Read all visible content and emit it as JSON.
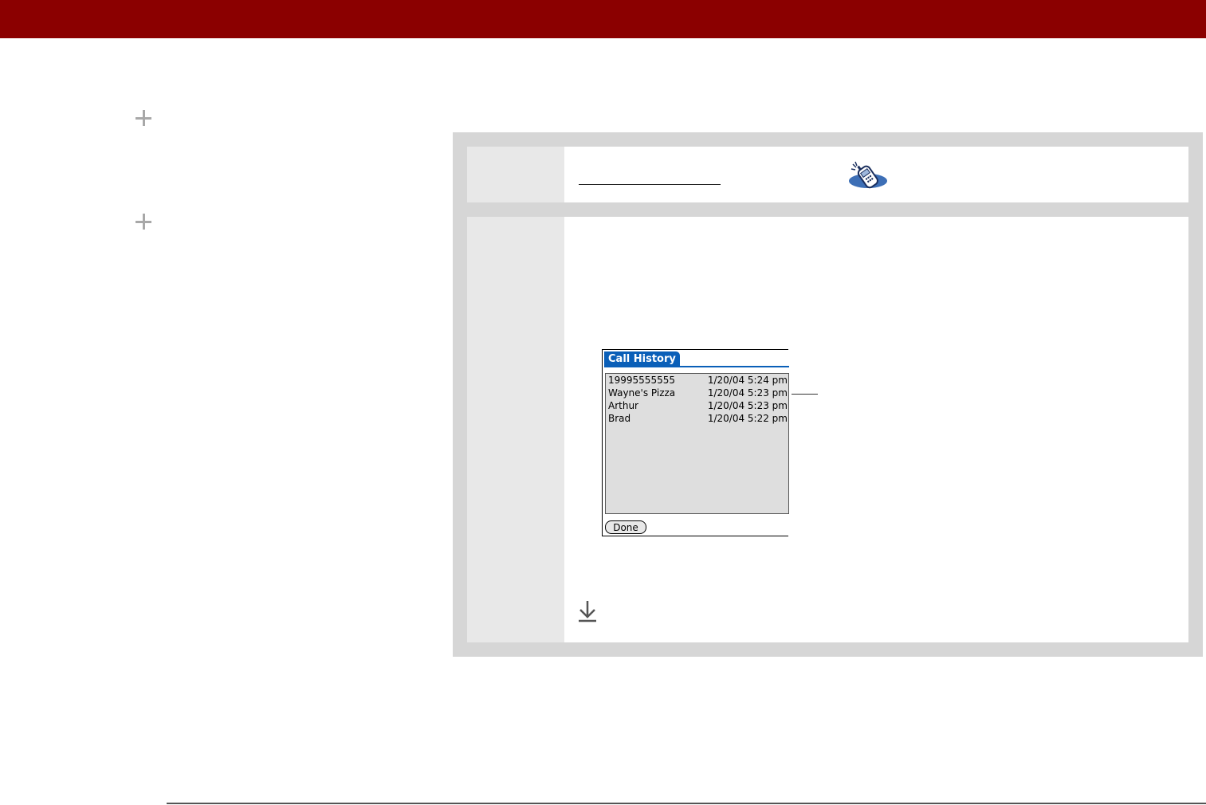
{
  "call_history": {
    "title": "Call History",
    "entries": [
      {
        "name": "19995555555",
        "time": "1/20/04 5:24 pm"
      },
      {
        "name": "Wayne's Pizza",
        "time": "1/20/04 5:23 pm"
      },
      {
        "name": "Arthur",
        "time": "1/20/04 5:23 pm"
      },
      {
        "name": "Brad",
        "time": "1/20/04 5:22 pm"
      }
    ],
    "done_label": "Done"
  },
  "colors": {
    "header_bar": "#8b0000",
    "panel_bg": "#d6d6d6",
    "device_accent": "#0a5fb8"
  },
  "icons": {
    "left_margin": [
      "plus-icon",
      "plus-icon"
    ],
    "step_icon": "phone-icon",
    "continue_icon": "down-arrow-icon"
  }
}
